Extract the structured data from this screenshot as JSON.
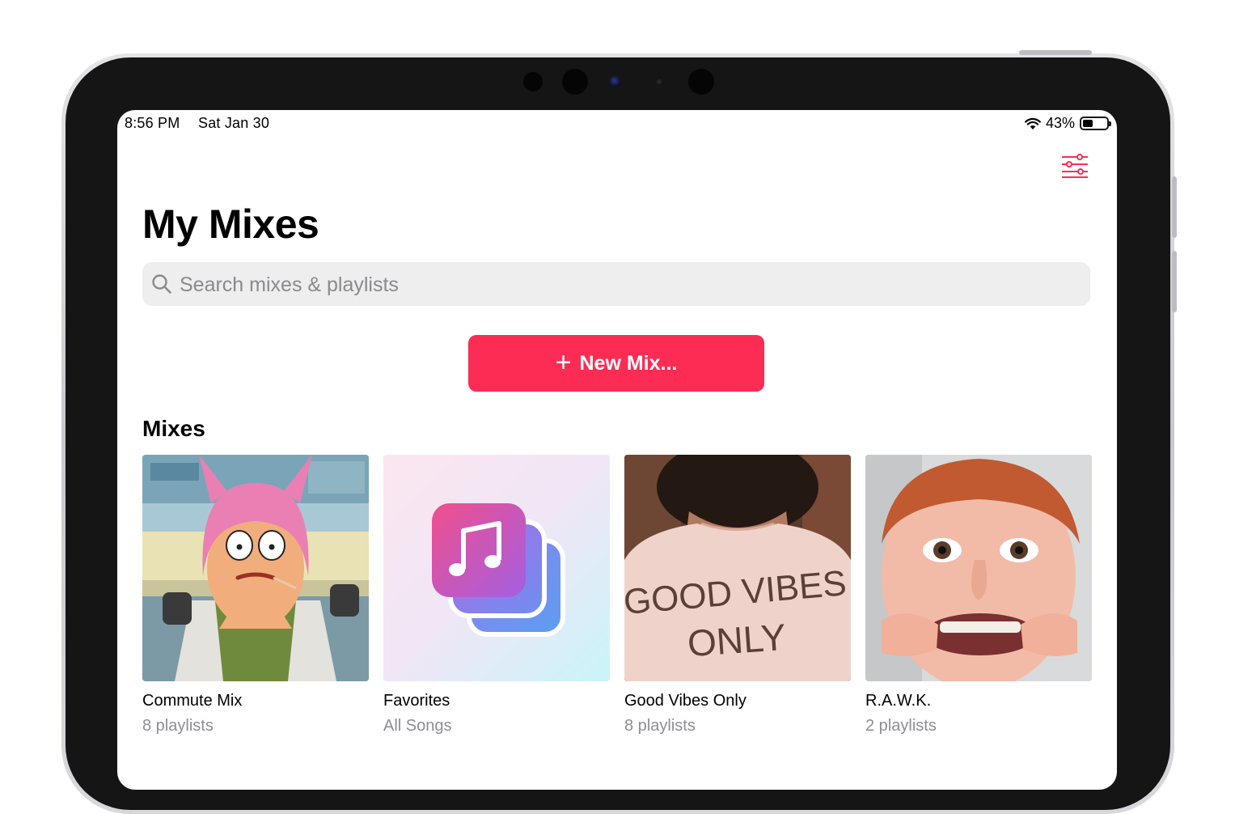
{
  "status_bar": {
    "time": "8:56 PM",
    "date": "Sat Jan 30",
    "battery_percent": "43%",
    "battery_level": 0.43,
    "wifi_icon": "wifi-icon",
    "battery_icon": "battery-icon"
  },
  "header": {
    "title": "My Mixes",
    "filter_icon": "sliders-icon"
  },
  "search": {
    "placeholder": "Search mixes & playlists",
    "value": "",
    "icon": "search-icon"
  },
  "new_mix_button": {
    "icon": "plus-icon",
    "label": "New Mix..."
  },
  "mixes_section": {
    "heading": "Mixes",
    "items": [
      {
        "name": "Commute Mix",
        "subtitle": "8 playlists",
        "artwork": "cartoon-character-photo"
      },
      {
        "name": "Favorites",
        "subtitle": "All Songs",
        "artwork": "music-stack-icon"
      },
      {
        "name": "Good Vibes Only",
        "subtitle": "8 playlists",
        "artwork": "shirt-photo",
        "artwork_text": [
          "GOOD VIBES",
          "ONLY"
        ]
      },
      {
        "name": "R.A.W.K.",
        "subtitle": "2 playlists",
        "artwork": "child-face-photo"
      }
    ]
  },
  "colors": {
    "accent": "#fc2c55",
    "search_bg": "#eeeeef",
    "secondary_text": "#8e8e93"
  }
}
